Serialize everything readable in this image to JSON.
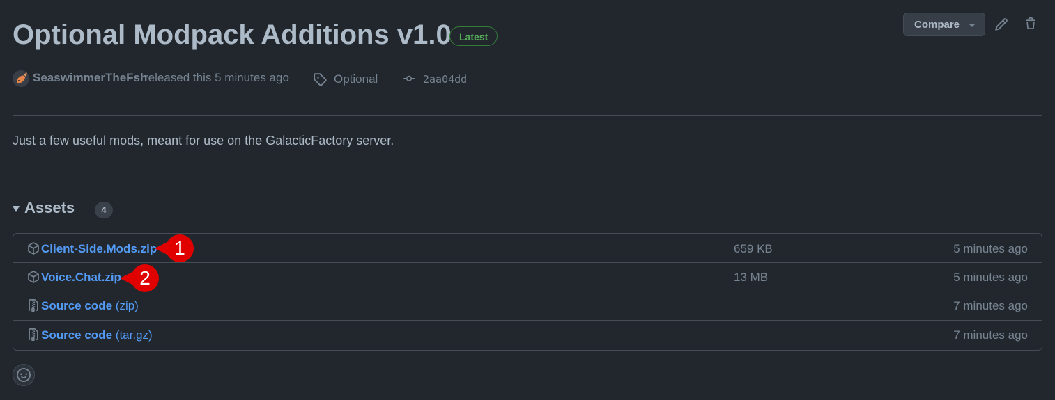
{
  "release": {
    "title": "Optional Modpack Additions v1.0",
    "badge": "Latest",
    "author": "SeaswimmerTheFsh",
    "released_text": "released this 5 minutes ago",
    "tag": "Optional",
    "commit": "2aa04dd",
    "description": "Just a few useful mods, meant for use on the GalacticFactory server."
  },
  "toolbar": {
    "compare_label": "Compare"
  },
  "assets": {
    "title": "Assets",
    "count": "4",
    "items": [
      {
        "name": "Client-Side.Mods.zip",
        "suffix": "",
        "size": "659 KB",
        "time": "5 minutes ago",
        "icon": "package-icon"
      },
      {
        "name": "Voice.Chat.zip",
        "suffix": "",
        "size": "13 MB",
        "time": "5 minutes ago",
        "icon": "package-icon"
      },
      {
        "name": "Source code",
        "suffix": "(zip)",
        "size": "",
        "time": "7 minutes ago",
        "icon": "file-zip-icon"
      },
      {
        "name": "Source code",
        "suffix": "(tar.gz)",
        "size": "",
        "time": "7 minutes ago",
        "icon": "file-zip-icon"
      }
    ]
  },
  "annotations": [
    "1",
    "2"
  ],
  "colors": {
    "background": "#22272e",
    "link": "#539bf5",
    "latest": "#57ab5a",
    "callout": "#e00000"
  }
}
